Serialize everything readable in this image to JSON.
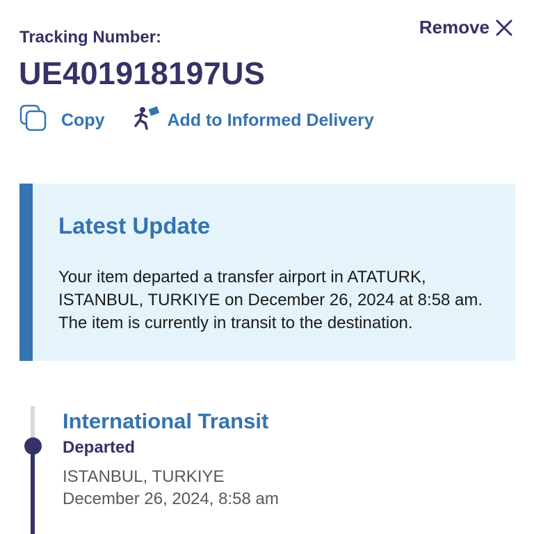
{
  "header": {
    "tracking_label": "Tracking Number:",
    "tracking_number": "UE401918197US",
    "remove_label": "Remove",
    "remove_icon": "close-icon"
  },
  "actions": {
    "copy_label": "Copy",
    "copy_icon": "copy-icon",
    "informed_label": "Add to Informed Delivery",
    "informed_icon": "informed-delivery-icon"
  },
  "latest_update": {
    "title": "Latest Update",
    "text": "Your item departed a transfer airport in ATATURK, ISTANBUL, TURKIYE on December 26, 2024 at 8:58 am. The item is currently in transit to the destination."
  },
  "timeline": {
    "events": [
      {
        "title": "International Transit",
        "status": "Departed",
        "location": "ISTANBUL, TURKIYE",
        "date": "December 26, 2024, 8:58 am"
      }
    ]
  },
  "colors": {
    "navy": "#333366",
    "blue": "#3573b1",
    "update_bg": "#e5f4fa",
    "gray_text": "#595959",
    "track_gray": "#d9d9d9"
  }
}
